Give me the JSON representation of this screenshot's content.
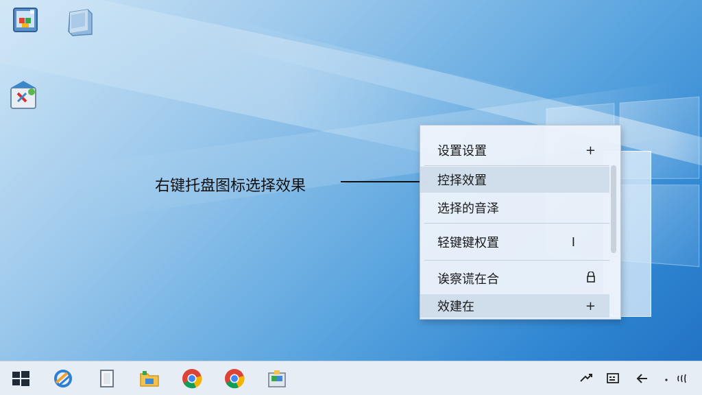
{
  "desktop": {
    "icons": [
      {
        "name": "desktop-icon-1"
      },
      {
        "name": "desktop-icon-2"
      },
      {
        "name": "desktop-icon-3"
      }
    ]
  },
  "annotation": {
    "label": "右键托盘图标选择效果"
  },
  "context_menu": {
    "items": [
      {
        "label": "设置设置",
        "suffix": "+"
      },
      {
        "label": "控择效置",
        "suffix": ""
      },
      {
        "label": "选择的音泽",
        "suffix": ""
      },
      {
        "label": "轻键键权置",
        "suffix": "I"
      },
      {
        "label": "诶察谎在合",
        "suffix": ""
      },
      {
        "label": "效建在",
        "suffix": "+"
      }
    ]
  },
  "taskbar": {
    "icons": [
      "windows-start-icon",
      "edge-icon",
      "notepad-icon",
      "file-explorer-icon",
      "chrome-icon",
      "chrome-icon",
      "app-package-icon"
    ],
    "tray": [
      "network-icon",
      "keyboard-icon",
      "back-icon",
      "dot-icon",
      "volume-icon"
    ]
  },
  "colors": {
    "accent": "#2f86d2",
    "taskbar_bg": "#e6edf4",
    "menu_bg": "#ecf3fa"
  }
}
